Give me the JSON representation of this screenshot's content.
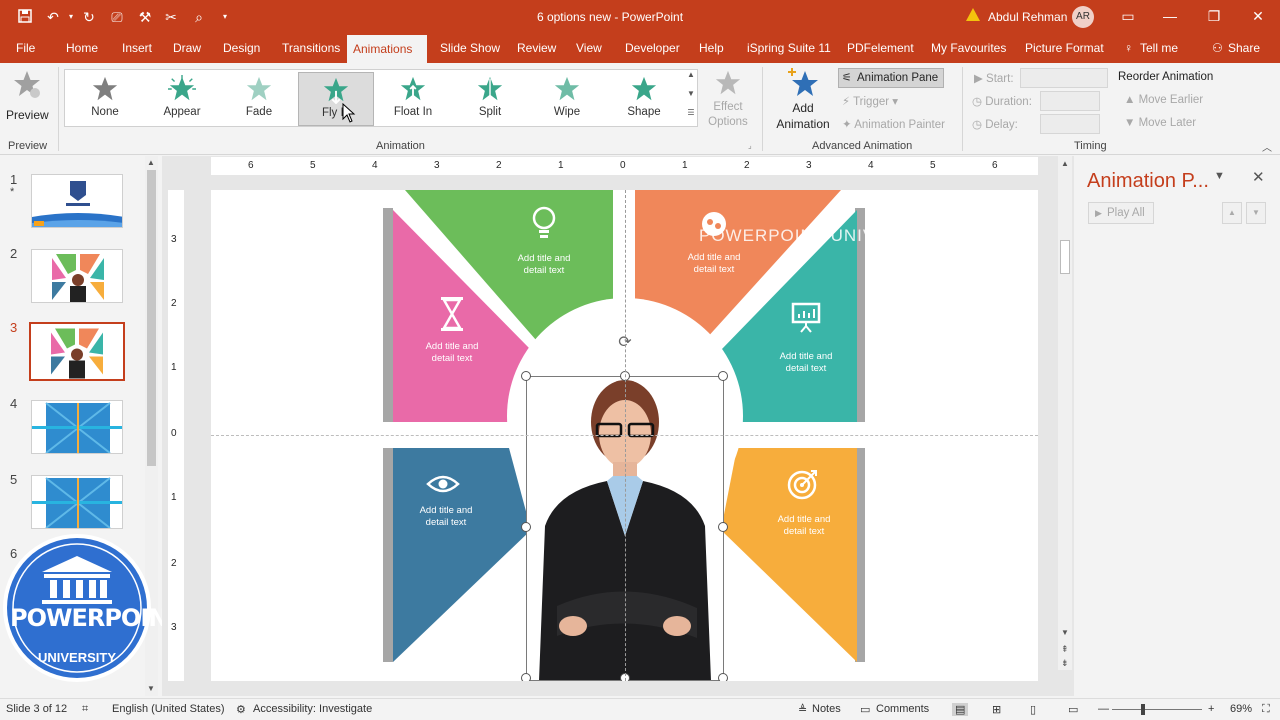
{
  "titlebar": {
    "doc_title": "6 options new  -  PowerPoint",
    "user_name": "Abdul Rehman",
    "user_initials": "AR"
  },
  "tabs": [
    "File",
    "Home",
    "Insert",
    "Draw",
    "Design",
    "Transitions",
    "Animations",
    "Slide Show",
    "Review",
    "View",
    "Developer",
    "Help",
    "iSpring Suite 11",
    "PDFelement",
    "My Favourites",
    "Picture Format",
    "Tell me",
    "Share"
  ],
  "active_tab": "Animations",
  "ribbon": {
    "preview": {
      "label": "Preview",
      "group": "Preview"
    },
    "gallery": [
      {
        "label": "None",
        "color": "#7f7f7f"
      },
      {
        "label": "Appear",
        "color": "#3aa68a"
      },
      {
        "label": "Fade",
        "color": "#9fd0c2"
      },
      {
        "label": "Fly In",
        "color": "#3aa68a"
      },
      {
        "label": "Float In",
        "color": "#3aa68a"
      },
      {
        "label": "Split",
        "color": "#3aa68a"
      },
      {
        "label": "Wipe",
        "color": "#6fbca6"
      },
      {
        "label": "Shape",
        "color": "#3aa68a"
      }
    ],
    "selected_effect": "Fly In",
    "animation_group": "Animation",
    "effect_options_1": "Effect",
    "effect_options_2": "Options",
    "add_animation_1": "Add",
    "add_animation_2": "Animation",
    "animation_pane_btn": "Animation Pane",
    "trigger": "Trigger",
    "animation_painter": "Animation Painter",
    "advanced_group": "Advanced Animation",
    "start": "Start:",
    "duration": "Duration:",
    "delay": "Delay:",
    "reorder": "Reorder Animation",
    "move_earlier": "Move Earlier",
    "move_later": "Move Later",
    "timing_group": "Timing"
  },
  "ruler_h": [
    "6",
    "5",
    "4",
    "3",
    "2",
    "1",
    "0",
    "1",
    "2",
    "3",
    "4",
    "5",
    "6"
  ],
  "ruler_v": [
    "3",
    "2",
    "1",
    "0",
    "1",
    "2",
    "3"
  ],
  "slides": [
    {
      "num": "1",
      "star": "*"
    },
    {
      "num": "2"
    },
    {
      "num": "3"
    },
    {
      "num": "4"
    },
    {
      "num": "5"
    },
    {
      "num": "6"
    }
  ],
  "slide_content": {
    "watermark": "POWERPOINT UNIVERSITY",
    "cards": [
      {
        "text1": "Add title and",
        "text2": "detail text",
        "color": "#6cbd5a",
        "icon": "lightbulb-icon"
      },
      {
        "text1": "Add title and",
        "text2": "detail text",
        "color": "#f0875a",
        "icon": "brain-icon"
      },
      {
        "text1": "Add title and",
        "text2": "detail text",
        "color": "#e96aa8",
        "icon": "hourglass-icon"
      },
      {
        "text1": "Add title and",
        "text2": "detail text",
        "color": "#3ab5a8",
        "icon": "presentation-icon"
      },
      {
        "text1": "Add title and",
        "text2": "detail text",
        "color": "#3d7aa0",
        "icon": "eye-icon"
      },
      {
        "text1": "Add title and",
        "text2": "detail text",
        "color": "#f7ad3c",
        "icon": "target-icon"
      }
    ]
  },
  "animation_pane": {
    "title": "Animation P...",
    "play_all": "Play All"
  },
  "logo": {
    "line1": "POWERPOINT",
    "line2": "UNIVERSITY"
  },
  "status": {
    "slide_info": "Slide 3 of 12",
    "language": "English (United States)",
    "accessibility": "Accessibility: Investigate",
    "notes": "Notes",
    "comments": "Comments",
    "zoom": "69%"
  }
}
